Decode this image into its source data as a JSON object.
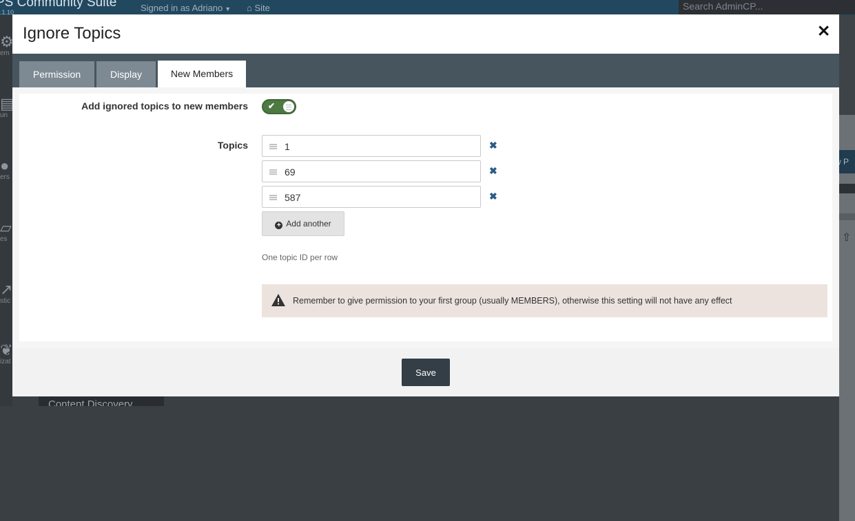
{
  "background": {
    "brand": "PS Community Suite",
    "version": ".1.10",
    "signed_in": "Signed in as Adriano",
    "site_link": "Site",
    "search_placeholder": "Search AdminCP...",
    "sidebar_labels": [
      "em",
      "un",
      "ers",
      "es",
      "stic",
      "izat"
    ],
    "right_button_text": "w P",
    "bottom_tab": "Content Discovery"
  },
  "modal": {
    "title": "Ignore Topics",
    "close_glyph": "✕",
    "tabs": [
      {
        "label": "Permission",
        "active": false
      },
      {
        "label": "Display",
        "active": false
      },
      {
        "label": "New Members",
        "active": true
      }
    ],
    "form": {
      "add_label": "Add ignored topics to new members",
      "add_enabled": true,
      "topics_label": "Topics",
      "topics": [
        "1",
        "69",
        "587"
      ],
      "add_another": "Add another",
      "help_text": "One topic ID per row",
      "warning_text": "Remember to give permission to your first group (usually MEMBERS), otherwise this setting will not have any effect"
    },
    "save_label": "Save"
  },
  "colors": {
    "toggle_on": "#4d7a43",
    "tabbar": "#47555f",
    "save_button": "#333e47",
    "remove_icon": "#2b5a85",
    "warning_bg": "#ece3df"
  }
}
